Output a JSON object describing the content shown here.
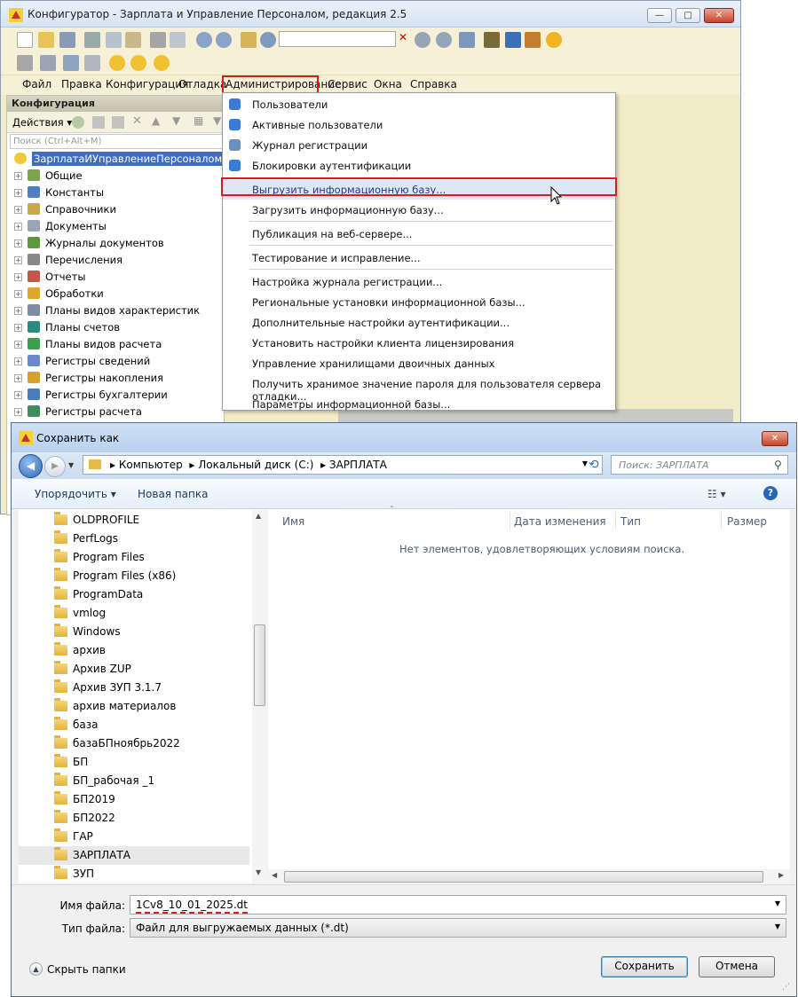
{
  "main_window": {
    "title": "Конфигуратор - Зарплата и Управление Персоналом, редакция 2.5",
    "menu": [
      "Файл",
      "Правка",
      "Конфигурация",
      "Отладка",
      "Администрирование",
      "Сервис",
      "Окна",
      "Справка"
    ],
    "panel_title": "Конфигурация",
    "actions_label": "Действия",
    "search_placeholder": "Поиск (Ctrl+Alt+M)",
    "tree_root": "ЗарплатаИУправлениеПерсоналом",
    "tree_items": [
      "Общие",
      "Константы",
      "Справочники",
      "Документы",
      "Журналы документов",
      "Перечисления",
      "Отчеты",
      "Обработки",
      "Планы видов характеристик",
      "Планы счетов",
      "Планы видов расчета",
      "Регистры сведений",
      "Регистры накопления",
      "Регистры бухгалтерии",
      "Регистры расчета"
    ]
  },
  "admin_menu": {
    "items": [
      "Пользователи",
      "Активные пользователи",
      "Журнал регистрации",
      "Блокировки аутентификации",
      "Выгрузить информационную базу...",
      "Загрузить информационную базу...",
      "Публикация на веб-сервере...",
      "Тестирование и исправление...",
      "Настройка журнала регистрации...",
      "Региональные установки информационной базы...",
      "Дополнительные настройки аутентификации...",
      "Установить настройки клиента лицензирования",
      "Управление хранилищами двоичных данных",
      "Получить хранимое значение пароля для пользователя сервера отладки...",
      "Параметры информационной базы..."
    ]
  },
  "save_dialog": {
    "title": "Сохранить как",
    "path": [
      "Компьютер",
      "Локальный диск (C:)",
      "ЗАРПЛАТА"
    ],
    "search_placeholder": "Поиск: ЗАРПЛАТА",
    "organize_label": "Упорядочить",
    "new_folder_label": "Новая папка",
    "folders": [
      "OLDPROFILE",
      "PerfLogs",
      "Program Files",
      "Program Files (x86)",
      "ProgramData",
      "vmlog",
      "Windows",
      "архив",
      "Архив ZUP",
      "Архив ЗУП 3.1.7",
      "архив материалов",
      "база",
      "базаБПноябрь2022",
      "БП",
      "БП_рабочая _1",
      "БП2019",
      "БП2022",
      "ГАР",
      "ЗАРПЛАТА",
      "ЗУП"
    ],
    "selected_folder": "ЗАРПЛАТА",
    "columns": [
      "Имя",
      "Дата изменения",
      "Тип",
      "Размер"
    ],
    "empty_message": "Нет элементов, удовлетворяющих условиям поиска.",
    "filename_label": "Имя файла:",
    "filename_value": "1Cv8_10_01_2025.dt",
    "filetype_label": "Тип файла:",
    "filetype_value": "Файл для выгружаемых данных (*.dt)",
    "hide_folders_label": "Скрыть папки",
    "save_label": "Сохранить",
    "cancel_label": "Отмена"
  },
  "colors": {
    "accent_red": "#d2201f",
    "menu_bg": "#f6f1d6",
    "dialog_title": "#b9d1ee"
  }
}
